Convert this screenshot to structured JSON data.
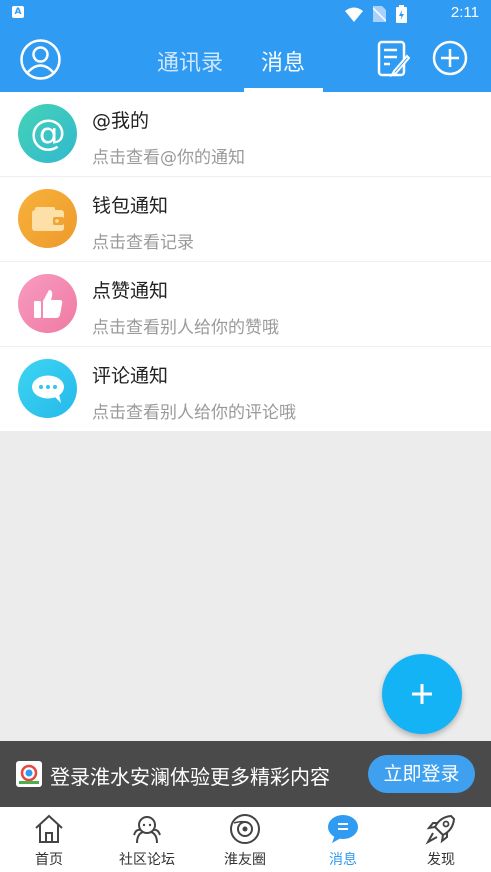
{
  "status_bar": {
    "time": "2:11",
    "app_badge": "A"
  },
  "header": {
    "tabs": [
      {
        "label": "通讯录",
        "active": false
      },
      {
        "label": "消息",
        "active": true
      }
    ]
  },
  "messages": [
    {
      "title": "@我的",
      "subtitle": "点击查看@你的通知",
      "icon": "at-icon",
      "color": "#3ec9b8"
    },
    {
      "title": "钱包通知",
      "subtitle": "点击查看记录",
      "icon": "wallet-icon",
      "color": "#f2a330"
    },
    {
      "title": "点赞通知",
      "subtitle": "点击查看别人给你的赞哦",
      "icon": "thumbs-up-icon",
      "color": "#f58ab0"
    },
    {
      "title": "评论通知",
      "subtitle": "点击查看别人给你的评论哦",
      "icon": "comment-icon",
      "color": "#2dc7ee"
    }
  ],
  "banner": {
    "text": "登录淮水安澜体验更多精彩内容",
    "button": "立即登录"
  },
  "bottom_nav": [
    {
      "label": "首页",
      "icon": "home-icon",
      "active": false
    },
    {
      "label": "社区论坛",
      "icon": "community-icon",
      "active": false
    },
    {
      "label": "淮友圈",
      "icon": "moments-icon",
      "active": false
    },
    {
      "label": "消息",
      "icon": "message-icon",
      "active": true
    },
    {
      "label": "发现",
      "icon": "rocket-icon",
      "active": false
    }
  ],
  "colors": {
    "primary": "#2f9bf3",
    "fab": "#14b3f5",
    "banner_bg": "#4a4a4a"
  }
}
